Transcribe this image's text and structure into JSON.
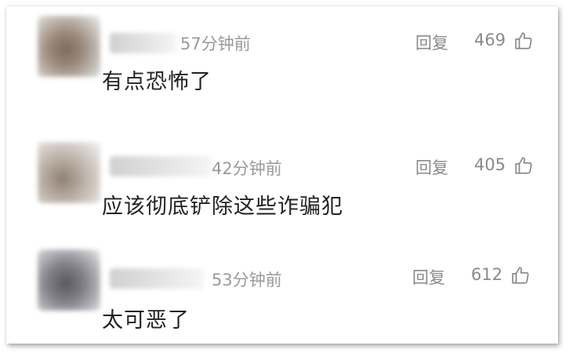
{
  "comments": [
    {
      "time": "57分钟前",
      "reply_label": "回复",
      "likes": "469",
      "text": "有点恐怖了"
    },
    {
      "time": "42分钟前",
      "reply_label": "回复",
      "likes": "405",
      "text": "应该彻底铲除这些诈骗犯"
    },
    {
      "time": "53分钟前",
      "reply_label": "回复",
      "likes": "612",
      "text": "太可恶了"
    }
  ],
  "icons": {
    "like": "thumbs-up-icon"
  },
  "colors": {
    "meta_text": "#9a9a9a",
    "body_text": "#222222",
    "background": "#ffffff"
  }
}
